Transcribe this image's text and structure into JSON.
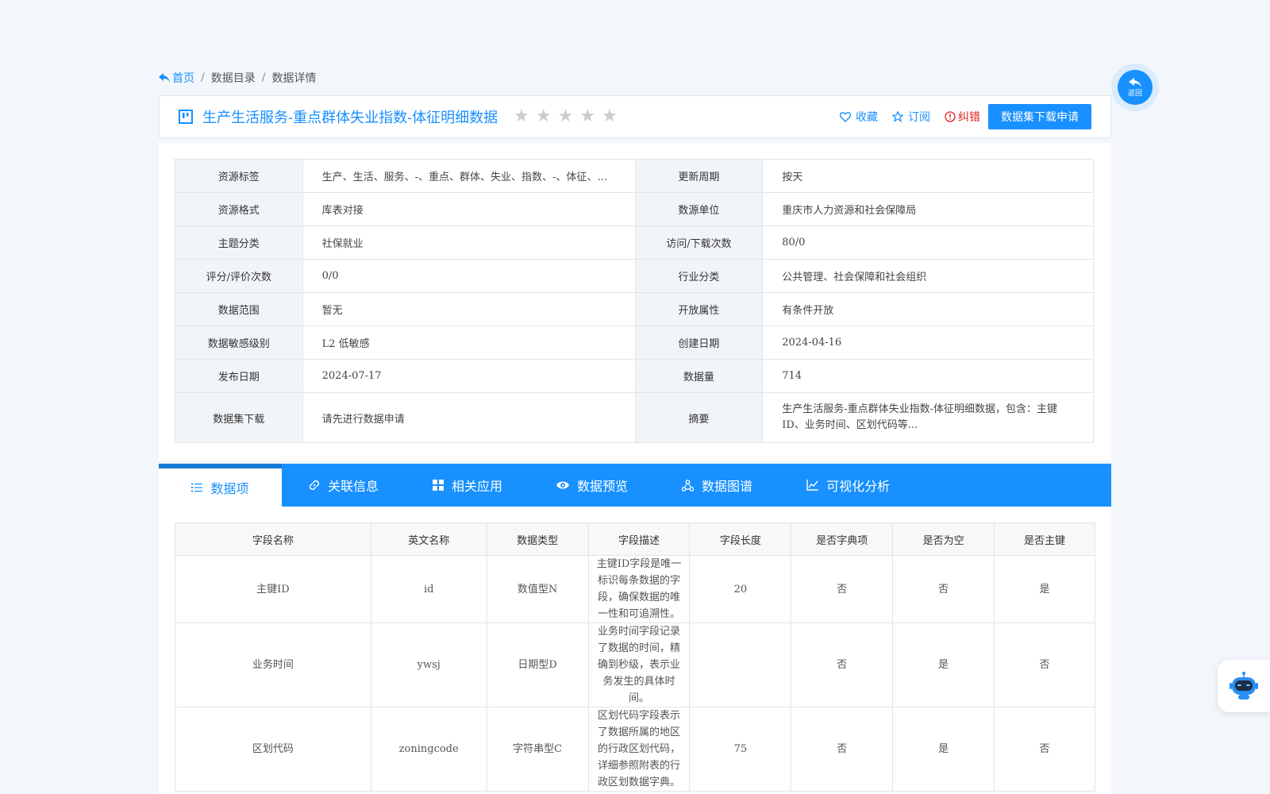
{
  "breadcrumb": {
    "home": "首页",
    "sep1": "/",
    "catalog": "数据目录",
    "sep2": "/",
    "current": "数据详情"
  },
  "title": "生产生活服务-重点群体失业指数-体征明细数据",
  "rating": {
    "stars_total": 5,
    "stars_filled": 0
  },
  "actions": {
    "favorite": "收藏",
    "subscribe": "订阅",
    "report": "纠错",
    "apply": "数据集下载申请"
  },
  "info": [
    {
      "k1": "资源标签",
      "v1": "生产、生活、服务、-、重点、群体、失业、指数、-、体征、明细、数据",
      "k2": "更新周期",
      "v2": "按天"
    },
    {
      "k1": "资源格式",
      "v1": "库表对接",
      "k2": "数源单位",
      "v2": "重庆市人力资源和社会保障局"
    },
    {
      "k1": "主题分类",
      "v1": "社保就业",
      "k2": "访问/下载次数",
      "v2": "80/0"
    },
    {
      "k1": "评分/评价次数",
      "v1": "0/0",
      "k2": "行业分类",
      "v2": "公共管理、社会保障和社会组织"
    },
    {
      "k1": "数据范围",
      "v1": "暂无",
      "k2": "开放属性",
      "v2": "有条件开放"
    },
    {
      "k1": "数据敏感级别",
      "v1": "L2 低敏感",
      "k2": "创建日期",
      "v2": "2024-04-16"
    },
    {
      "k1": "发布日期",
      "v1": "2024-07-17",
      "k2": "数据量",
      "v2": "714"
    },
    {
      "k1": "数据集下载",
      "v1": "请先进行数据申请",
      "k2": "摘要",
      "v2": "生产生活服务-重点群体失业指数-体征明细数据，包含：主键ID、业务时间、区划代码等..."
    }
  ],
  "tabs": [
    "数据项",
    "关联信息",
    "相关应用",
    "数据预览",
    "数据图谱",
    "可视化分析"
  ],
  "fields": {
    "headers": [
      "字段名称",
      "英文名称",
      "数据类型",
      "字段描述",
      "字段长度",
      "是否字典项",
      "是否为空",
      "是否主键"
    ],
    "rows": [
      [
        "主键ID",
        "id",
        "数值型N",
        "主键ID字段是唯一标识每条数据的字段，确保数据的唯一性和可追溯性。",
        "20",
        "否",
        "否",
        "是"
      ],
      [
        "业务时间",
        "ywsj",
        "日期型D",
        "业务时间字段记录了数据的时间，精确到秒级，表示业务发生的具体时间。",
        "",
        "否",
        "是",
        "否"
      ],
      [
        "区划代码",
        "zoningcode",
        "字符串型C",
        "区划代码字段表示了数据所属的地区的行政区划代码，详细参照附表的行政区划数据字典。",
        "75",
        "否",
        "是",
        "否"
      ]
    ]
  },
  "back_label": "返回",
  "colors": {
    "primary": "#1890ff",
    "danger": "#e02020",
    "page_bg": "#f3f7fc"
  }
}
